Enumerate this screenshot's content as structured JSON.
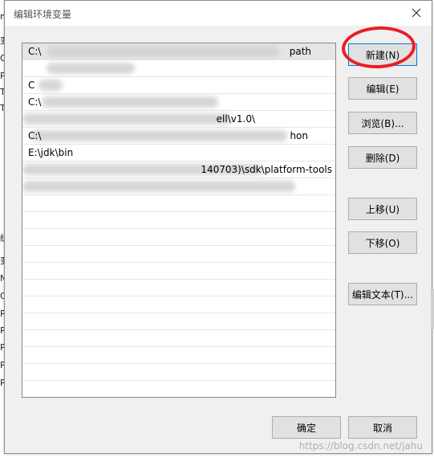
{
  "dialog": {
    "title": "编辑环境变量"
  },
  "path_list": {
    "rows": [
      {
        "left": "C:\\",
        "right": "path",
        "selected": true
      },
      {
        "left": "",
        "right": ""
      },
      {
        "left": "C",
        "right": ""
      },
      {
        "left": "C:\\",
        "right": ""
      },
      {
        "left": "",
        "right": "ell\\v1.0\\"
      },
      {
        "left": "C:\\",
        "right": "hon"
      },
      {
        "left": "E:\\jdk\\bin",
        "right": ""
      },
      {
        "left": "",
        "right": "140703)\\sdk\\platform-tools"
      },
      {
        "left": "",
        "right": ""
      },
      {
        "left": "",
        "right": ""
      },
      {
        "left": "",
        "right": ""
      },
      {
        "left": "",
        "right": ""
      },
      {
        "left": "",
        "right": ""
      },
      {
        "left": "",
        "right": ""
      },
      {
        "left": "",
        "right": ""
      },
      {
        "left": "",
        "right": ""
      },
      {
        "left": "",
        "right": ""
      },
      {
        "left": "",
        "right": ""
      },
      {
        "left": "",
        "right": ""
      },
      {
        "left": "",
        "right": ""
      },
      {
        "left": "",
        "right": ""
      }
    ]
  },
  "buttons": {
    "new": "新建(N)",
    "edit": "编辑(E)",
    "browse": "浏览(B)...",
    "delete": "删除(D)",
    "move_up": "上移(U)",
    "move_down": "下移(O)",
    "edit_text": "编辑文本(T)...",
    "ok": "确定",
    "cancel": "取消"
  },
  "watermark": "https://blog.csdn.net/jahu",
  "background_letters": [
    "m",
    "变",
    "O",
    "Pa",
    "TE",
    "TN",
    "",
    "",
    "",
    "",
    "",
    "",
    "",
    "统",
    "变",
    "NU",
    "O",
    "Pa",
    "PA",
    "PF",
    "PF",
    "PF"
  ]
}
